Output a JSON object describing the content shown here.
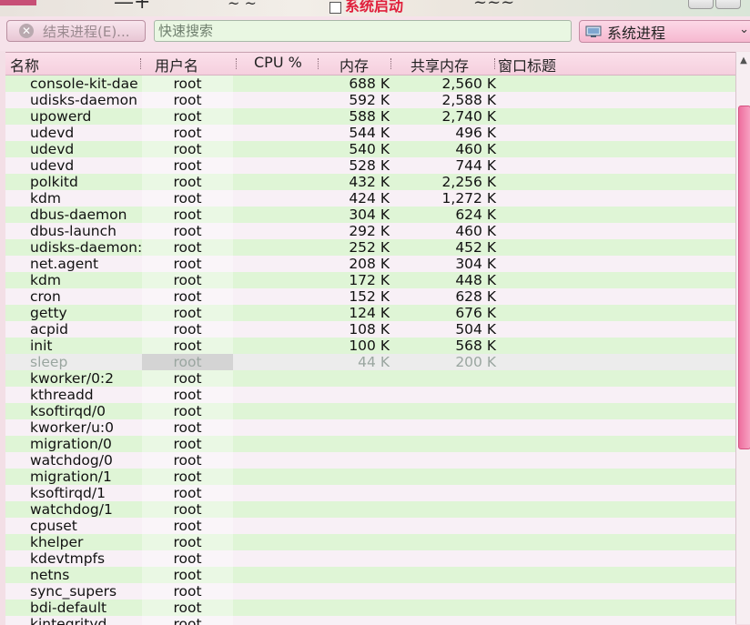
{
  "window": {
    "title": "系统启动"
  },
  "toolbar": {
    "end_process_label": "结束进程(E)...",
    "search_placeholder": "快速搜索",
    "filter_selected": "系统进程"
  },
  "table": {
    "columns": [
      "名称",
      "用户名",
      "CPU %",
      "内存",
      "共享内存",
      "窗口标题"
    ],
    "rows": [
      {
        "name": "console-kit-dae",
        "user": "root",
        "mem": "688 K",
        "shared": "2,560 K"
      },
      {
        "name": "udisks-daemon",
        "user": "root",
        "mem": "592 K",
        "shared": "2,588 K"
      },
      {
        "name": "upowerd",
        "user": "root",
        "mem": "588 K",
        "shared": "2,740 K"
      },
      {
        "name": "udevd",
        "user": "root",
        "mem": "544 K",
        "shared": "496 K"
      },
      {
        "name": "udevd",
        "user": "root",
        "mem": "540 K",
        "shared": "460 K"
      },
      {
        "name": "udevd",
        "user": "root",
        "mem": "528 K",
        "shared": "744 K"
      },
      {
        "name": "polkitd",
        "user": "root",
        "mem": "432 K",
        "shared": "2,256 K"
      },
      {
        "name": "kdm",
        "user": "root",
        "mem": "424 K",
        "shared": "1,272 K"
      },
      {
        "name": "dbus-daemon",
        "user": "root",
        "mem": "304 K",
        "shared": "624 K"
      },
      {
        "name": "dbus-launch",
        "user": "root",
        "mem": "292 K",
        "shared": "460 K"
      },
      {
        "name": "udisks-daemon:",
        "user": "root",
        "mem": "252 K",
        "shared": "452 K"
      },
      {
        "name": "net.agent",
        "user": "root",
        "mem": "208 K",
        "shared": "304 K"
      },
      {
        "name": "kdm",
        "user": "root",
        "mem": "172 K",
        "shared": "448 K"
      },
      {
        "name": "cron",
        "user": "root",
        "mem": "152 K",
        "shared": "628 K"
      },
      {
        "name": "getty",
        "user": "root",
        "mem": "124 K",
        "shared": "676 K"
      },
      {
        "name": "acpid",
        "user": "root",
        "mem": "108 K",
        "shared": "504 K"
      },
      {
        "name": "init",
        "user": "root",
        "mem": "100 K",
        "shared": "568 K"
      },
      {
        "name": "sleep",
        "user": "root",
        "mem": "44 K",
        "shared": "200 K"
      },
      {
        "name": "kworker/0:2",
        "user": "root",
        "mem": "",
        "shared": ""
      },
      {
        "name": "kthreadd",
        "user": "root",
        "mem": "",
        "shared": ""
      },
      {
        "name": "ksoftirqd/0",
        "user": "root",
        "mem": "",
        "shared": ""
      },
      {
        "name": "kworker/u:0",
        "user": "root",
        "mem": "",
        "shared": ""
      },
      {
        "name": "migration/0",
        "user": "root",
        "mem": "",
        "shared": ""
      },
      {
        "name": "watchdog/0",
        "user": "root",
        "mem": "",
        "shared": ""
      },
      {
        "name": "migration/1",
        "user": "root",
        "mem": "",
        "shared": ""
      },
      {
        "name": "ksoftirqd/1",
        "user": "root",
        "mem": "",
        "shared": ""
      },
      {
        "name": "watchdog/1",
        "user": "root",
        "mem": "",
        "shared": ""
      },
      {
        "name": "cpuset",
        "user": "root",
        "mem": "",
        "shared": ""
      },
      {
        "name": "khelper",
        "user": "root",
        "mem": "",
        "shared": ""
      },
      {
        "name": "kdevtmpfs",
        "user": "root",
        "mem": "",
        "shared": ""
      },
      {
        "name": "netns",
        "user": "root",
        "mem": "",
        "shared": ""
      },
      {
        "name": "sync_supers",
        "user": "root",
        "mem": "",
        "shared": ""
      },
      {
        "name": "bdi-default",
        "user": "root",
        "mem": "",
        "shared": ""
      },
      {
        "name": "kintegrityd",
        "user": "root",
        "mem": "",
        "shared": ""
      }
    ]
  },
  "colors": {
    "row_even": "#dff5d6",
    "row_odd": "#f8f0f6",
    "title_red": "#e0203c",
    "scroll_thumb": "#ee6f9f"
  }
}
